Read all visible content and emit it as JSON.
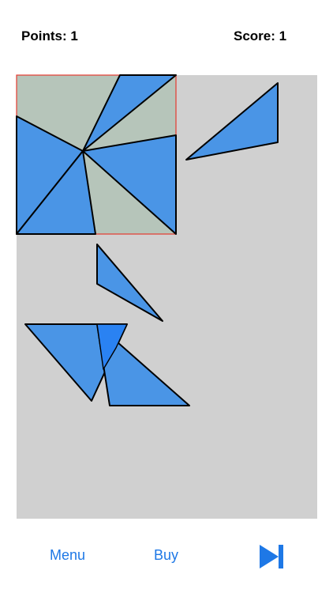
{
  "header": {
    "points_label": "Points:",
    "points_value": "1",
    "score_label": "Score:",
    "score_value": "1"
  },
  "footer": {
    "menu_label": "Menu",
    "buy_label": "Buy",
    "next_icon": "skip-forward-icon"
  },
  "colors": {
    "board_background": "#d0d0d0",
    "target_fill": "#b6c5ba",
    "target_border": "#e53a2f",
    "piece_fill": "#4a95e6",
    "piece_stroke": "#000000",
    "overlap_fill": "#2a82f2",
    "accent": "#1e78e6"
  },
  "puzzle": {
    "placed_pieces": 4,
    "loose_pieces": 4
  }
}
